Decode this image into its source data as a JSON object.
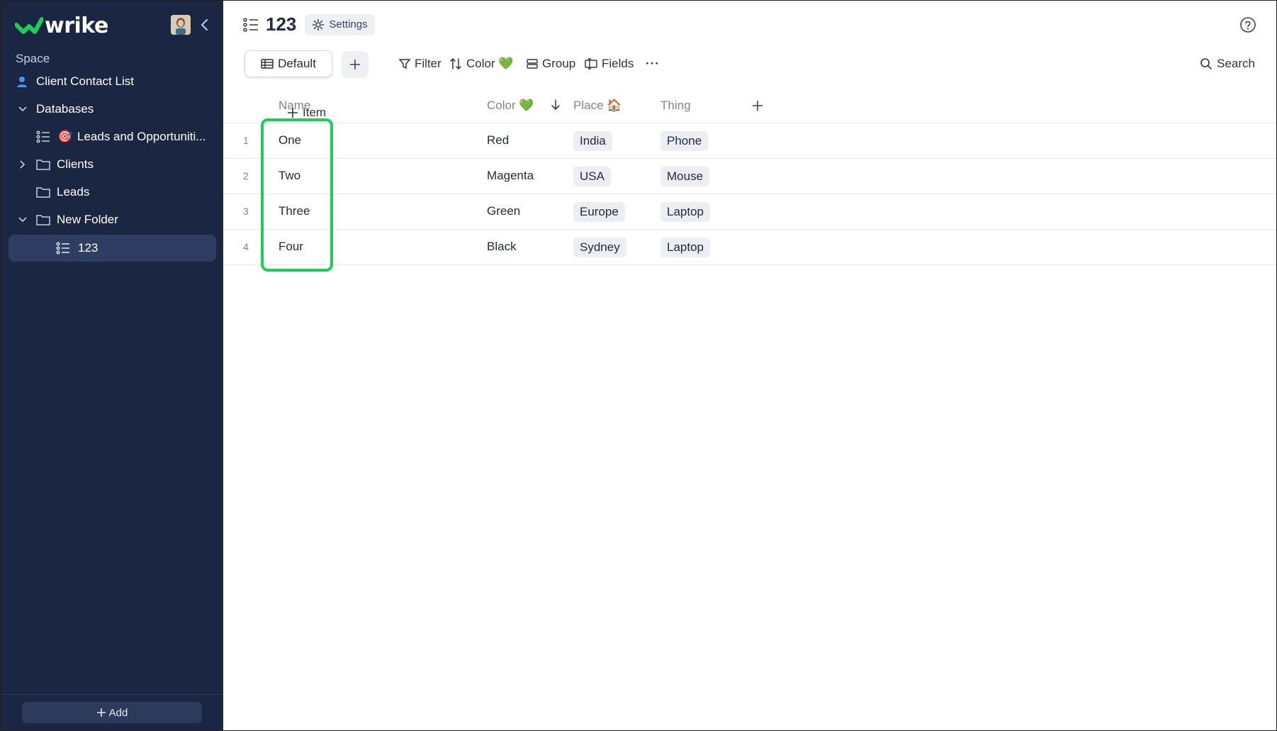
{
  "app": {
    "logo_text": "wrike"
  },
  "sidebar": {
    "space_label": "Space",
    "items": [
      {
        "label": "Client Contact List",
        "icon": "user-icon"
      },
      {
        "label": "Databases",
        "icon": "chevron-down-icon"
      },
      {
        "label": "Leads and Opportuniti...",
        "icon": "list-icon",
        "emoji": "🎯"
      },
      {
        "label": "Clients",
        "icon": "folder-icon"
      },
      {
        "label": "Leads",
        "icon": "folder-icon"
      },
      {
        "label": "New Folder",
        "icon": "folder-icon"
      },
      {
        "label": "123",
        "icon": "list-icon",
        "selected": true
      }
    ],
    "add_label": "Add"
  },
  "header": {
    "title": "123",
    "settings_label": "Settings"
  },
  "toolbar": {
    "view_label": "Default",
    "filter_label": "Filter",
    "sort_label": "Color 💚",
    "group_label": "Group",
    "fields_label": "Fields",
    "more_label": "···",
    "search_label": "Search"
  },
  "table": {
    "columns": {
      "name": "Name",
      "color": "Color 💚",
      "place": "Place 🏠",
      "thing": "Thing"
    },
    "rows": [
      {
        "num": "1",
        "name": "One",
        "color": "Red",
        "place": "India",
        "thing": "Phone"
      },
      {
        "num": "2",
        "name": "Two",
        "color": "Magenta",
        "place": "USA",
        "thing": "Mouse"
      },
      {
        "num": "3",
        "name": "Three",
        "color": "Green",
        "place": "Europe",
        "thing": "Laptop"
      },
      {
        "num": "4",
        "name": "Four",
        "color": "Black",
        "place": "Sydney",
        "thing": "Laptop"
      }
    ],
    "add_item_label": "Item"
  },
  "colors": {
    "sidebar_bg": "#1b2643",
    "selected_bg": "#2f3d63",
    "brand_green": "#1ecb5c",
    "highlight": "#1ecb5c"
  }
}
